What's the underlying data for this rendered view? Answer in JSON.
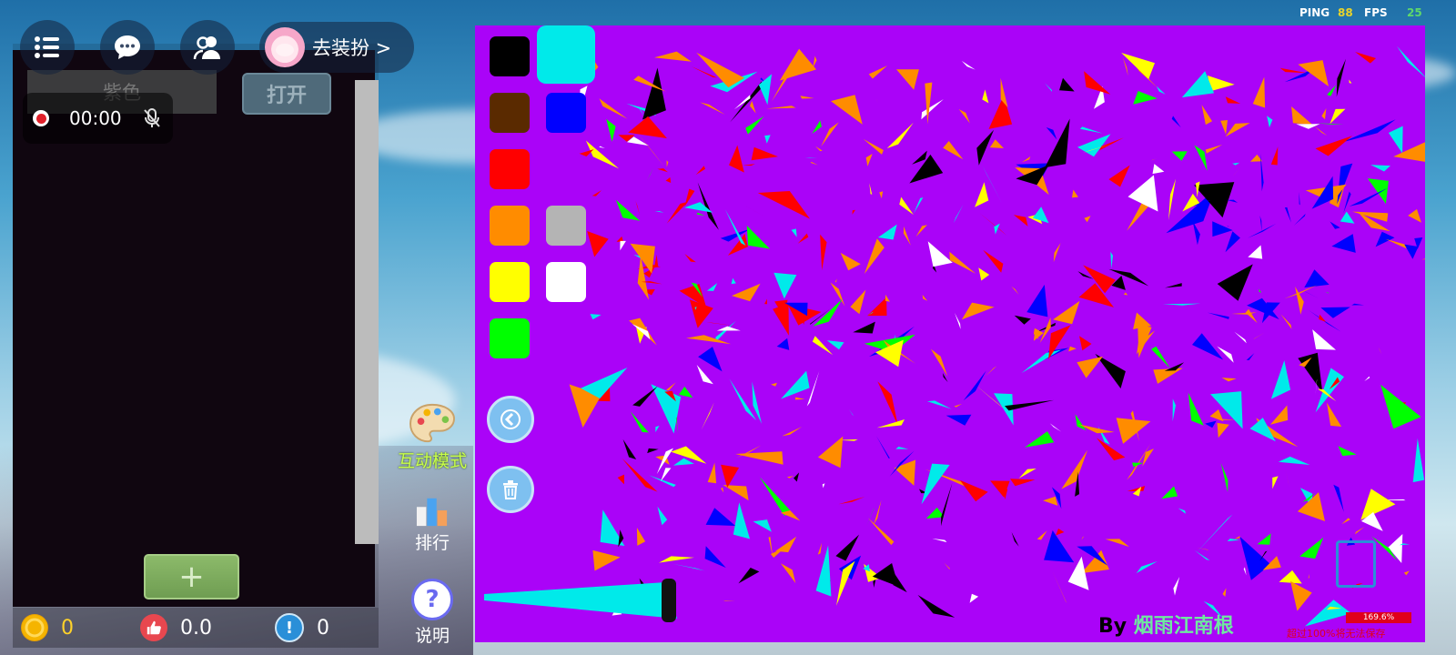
{
  "hud": {
    "ping_label": "PING",
    "ping_value": "88",
    "fps_label": "FPS",
    "fps_value": "25"
  },
  "top_bar": {
    "menu_icon": "list-icon",
    "chat_icon": "chat-bubble-icon",
    "friends_icon": "friends-icon",
    "dress_up_label": "去装扮 >"
  },
  "recorder": {
    "time": "00:00",
    "mic_icon": "mic-muted-icon"
  },
  "left_panel": {
    "color_name": "紫色",
    "open_button": "打开",
    "add_button": "+"
  },
  "stats": {
    "coins": "0",
    "likes": "0.0",
    "reports": "0",
    "report_icon_text": "!"
  },
  "side_menu": {
    "interact_mode": "互动模式",
    "ranking": "排行",
    "help": "说明",
    "help_icon_text": "?"
  },
  "palette": {
    "selected": "#00eaea",
    "colors": [
      "#000000",
      "#00eaea",
      "#5a2a00",
      "#0000ff",
      "#ff0000",
      "#ff8c00",
      "#b4b4b4",
      "#ffff00",
      "#ffffff",
      "#00ff00"
    ]
  },
  "canvas": {
    "background": "#aa03f8",
    "author_prefix": "By ",
    "author_name": "烟雨江南根",
    "percent": "169.6%",
    "warning": "超过100%将无法保存"
  },
  "colors": {
    "coin": "#ffd22a",
    "like": "#e8474f",
    "report": "#2a8fd8",
    "hud_value": "#e8d32a",
    "fps_value": "#5fd86a"
  }
}
